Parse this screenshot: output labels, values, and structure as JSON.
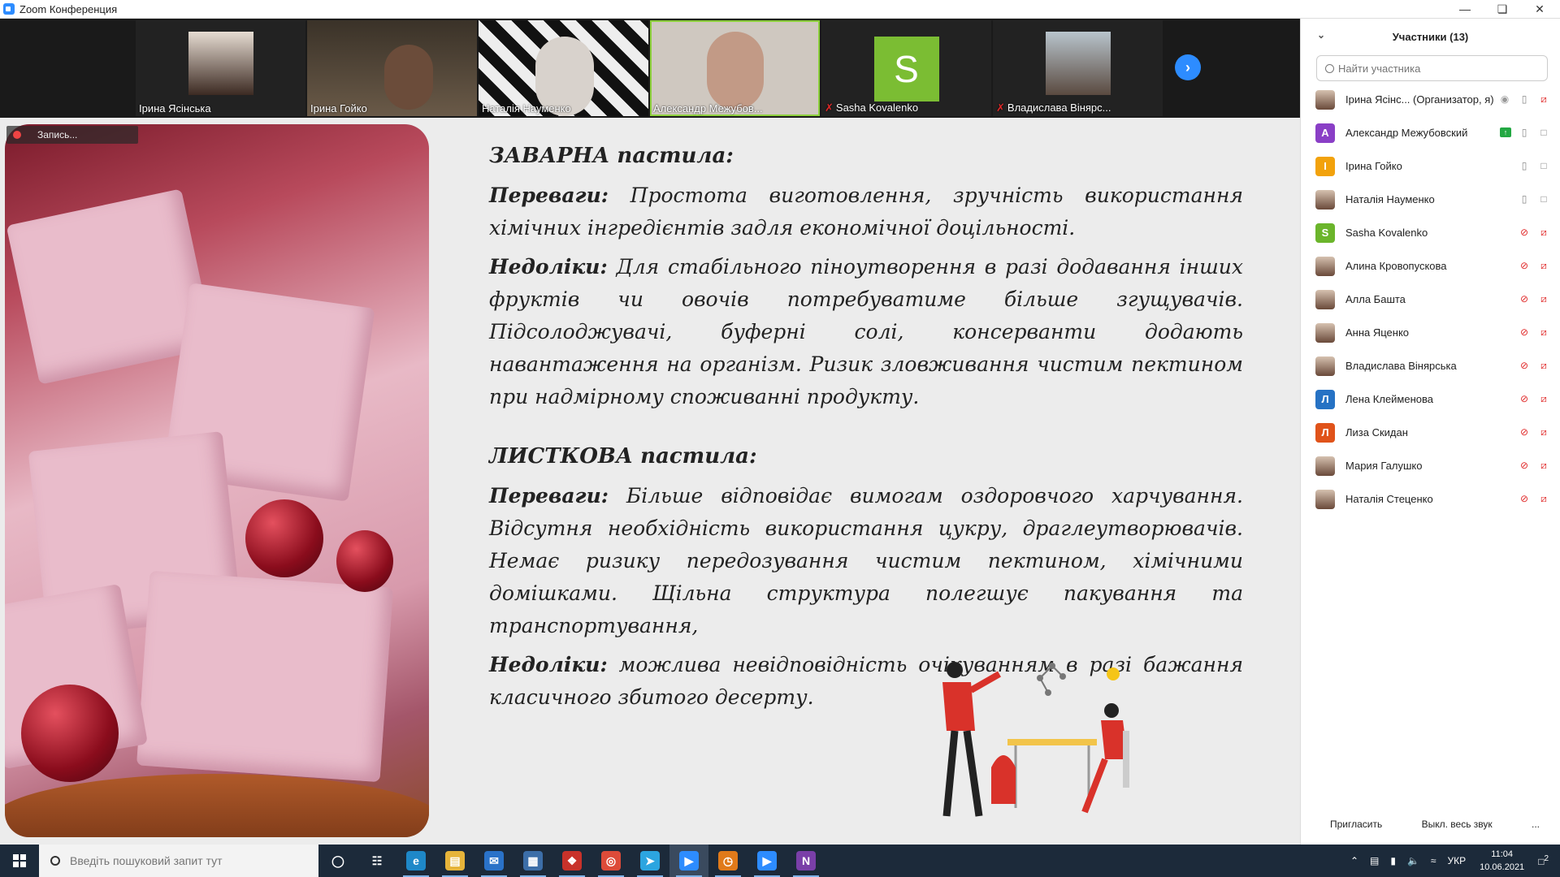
{
  "window": {
    "title": "Zoom Конференция",
    "controls": [
      "minimize-icon",
      "restore-icon",
      "close-icon"
    ]
  },
  "video_strip": {
    "tiles": [
      {
        "name": "Ірина Ясінська",
        "muted": false,
        "type": "photo"
      },
      {
        "name": "Ірина Гойко",
        "muted": false,
        "type": "video"
      },
      {
        "name": "Наталія Науменко",
        "muted": false,
        "type": "video"
      },
      {
        "name": "Александр Межубов...",
        "muted": false,
        "type": "video",
        "active": true
      },
      {
        "name": "Sasha Kovalenko",
        "muted": true,
        "type": "letter",
        "letter": "S"
      },
      {
        "name": "Владислава Вінярс...",
        "muted": true,
        "type": "photo"
      }
    ],
    "next_icon": "chevron-right-icon"
  },
  "share": {
    "recording_label": "Запись...",
    "slide": {
      "heading1": "ЗАВАРНА пастила:",
      "p1_label": "Переваги:",
      "p1_text": " Простота виготовлення, зручність використання хімічних інгредієнтів задля економічної доцільності.",
      "p2_label": "Недоліки:",
      "p2_text": " Для стабільного піноутворення в разі додавання інших фруктів чи овочів потребуватиме  більше згущувачів. Підсолоджувачі, буферні солі, консерванти додають навантаження на організм. Ризик зловживання чистим пектином при надмірному споживанні продукту.",
      "heading2": "ЛИСТКОВА пастила:",
      "p3_label": "Переваги:",
      "p3_text": " Більше відповідає вимогам оздоровчого харчування. Відсутня необхідність використання цукру, драглеутворювачів. Немає ризику передозування чистим пектином, хімічними домішками. Щільна структура полегшує пакування та транспортування,",
      "p4_label": "Недоліки:",
      "p4_text": " можлива невідповідність очікуванням в разі бажання класичного збитого десерту."
    }
  },
  "participants": {
    "title": "Участники (13)",
    "search_placeholder": "Найти участника",
    "list": [
      {
        "name": "Ірина Ясінс... (Организатор, я)",
        "avatar": "photo",
        "color": "",
        "mic": "on",
        "cam": "off",
        "extra": "record"
      },
      {
        "name": "Александр Межубовский",
        "avatar": "letter",
        "letter": "A",
        "color": "#8a3fc6",
        "mic": "on",
        "cam": "on",
        "extra": "share"
      },
      {
        "name": "Ірина Гойко",
        "avatar": "letter",
        "letter": "I",
        "color": "#f2a20c",
        "mic": "on",
        "cam": "on",
        "extra": ""
      },
      {
        "name": "Наталія Науменко",
        "avatar": "photo",
        "color": "",
        "mic": "on",
        "cam": "on",
        "extra": ""
      },
      {
        "name": "Sasha Kovalenko",
        "avatar": "letter",
        "letter": "S",
        "color": "#6bb52b",
        "mic": "off",
        "cam": "off",
        "extra": ""
      },
      {
        "name": "Алина Кровопускова",
        "avatar": "photo",
        "color": "",
        "mic": "off",
        "cam": "off",
        "extra": ""
      },
      {
        "name": "Алла Башта",
        "avatar": "photo",
        "color": "",
        "mic": "off",
        "cam": "off",
        "extra": ""
      },
      {
        "name": "Анна Яценко",
        "avatar": "photo",
        "color": "",
        "mic": "off",
        "cam": "off",
        "extra": ""
      },
      {
        "name": "Владислава Вінярська",
        "avatar": "photo",
        "color": "",
        "mic": "off",
        "cam": "off",
        "extra": ""
      },
      {
        "name": "Лена Клейменова",
        "avatar": "letter",
        "letter": "Л",
        "color": "#2672c4",
        "mic": "off",
        "cam": "off",
        "extra": ""
      },
      {
        "name": "Лиза Скидан",
        "avatar": "letter",
        "letter": "Л",
        "color": "#e0531a",
        "mic": "off",
        "cam": "off",
        "extra": ""
      },
      {
        "name": "Мария Галушко",
        "avatar": "photo",
        "color": "",
        "mic": "off",
        "cam": "off",
        "extra": ""
      },
      {
        "name": "Наталія Стеценко",
        "avatar": "photo",
        "color": "",
        "mic": "off",
        "cam": "off",
        "extra": ""
      }
    ],
    "footer": {
      "invite": "Пригласить",
      "mute_all": "Выкл. весь звук",
      "more": "..."
    }
  },
  "taskbar": {
    "search_placeholder": "Введіть пошуковий запит тут",
    "apps": [
      "cortana-icon",
      "task-view-icon",
      "edge-icon",
      "file-explorer-icon",
      "mail-icon",
      "store-icon",
      "gift-icon",
      "chrome-icon",
      "telegram-icon",
      "zoom-icon",
      "clock-app-icon",
      "zoom-meeting-icon",
      "onenote-icon"
    ],
    "language": "УКР",
    "time": "11:04",
    "date": "10.06.2021",
    "notifications": "2"
  },
  "colors": {
    "zoom_blue": "#2d8cff",
    "muted_red": "#e02828",
    "active_green": "#8ccf3b"
  }
}
